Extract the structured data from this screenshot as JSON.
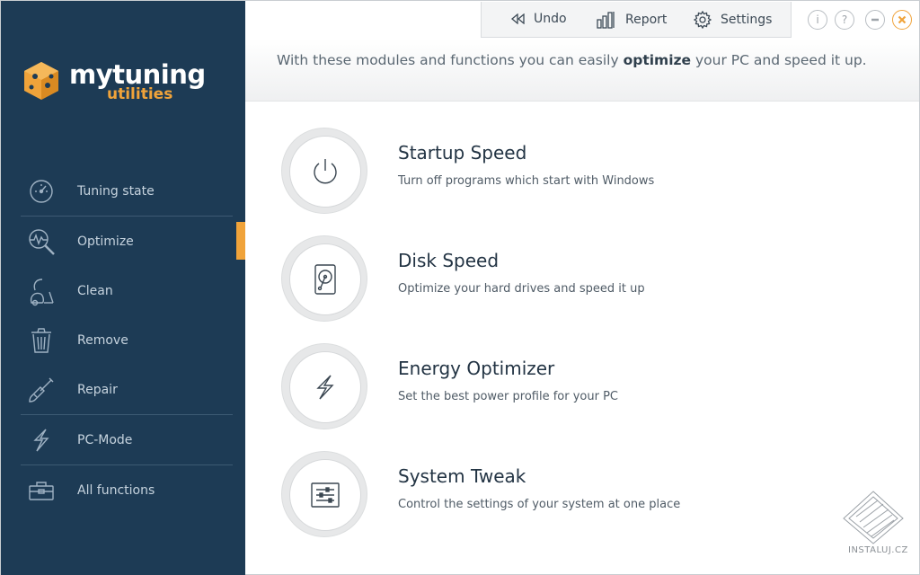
{
  "app": {
    "logo_line1": "mytuning",
    "logo_line2": "utilities"
  },
  "sidebar": {
    "items": [
      {
        "label": "Tuning state",
        "icon": "speedometer-icon"
      },
      {
        "label": "Optimize",
        "icon": "optimize-magnifier-icon",
        "active": true
      },
      {
        "label": "Clean",
        "icon": "vacuum-icon"
      },
      {
        "label": "Remove",
        "icon": "trash-icon"
      },
      {
        "label": "Repair",
        "icon": "screwdriver-icon"
      },
      {
        "label": "PC-Mode",
        "icon": "lightning-icon"
      },
      {
        "label": "All functions",
        "icon": "toolbox-icon"
      }
    ]
  },
  "toolbar": {
    "undo_label": "Undo",
    "report_label": "Report",
    "settings_label": "Settings"
  },
  "window_controls": {
    "info": "i",
    "help": "?"
  },
  "header": {
    "text_before": "With these modules and functions you can easily ",
    "text_bold": "optimize",
    "text_after": " your PC and speed it up."
  },
  "modules": [
    {
      "title": "Startup Speed",
      "description": "Turn off programs which start with Windows",
      "icon": "power-icon"
    },
    {
      "title": "Disk Speed",
      "description": "Optimize your hard drives and speed it up",
      "icon": "hard-drive-icon"
    },
    {
      "title": "Energy Optimizer",
      "description": "Set the best power profile for your PC",
      "icon": "lightning-icon"
    },
    {
      "title": "System Tweak",
      "description": "Control the settings of your system at one place",
      "icon": "sliders-icon"
    }
  ],
  "watermark": {
    "text": "INSTALUJ.CZ"
  },
  "colors": {
    "sidebar_bg": "#1d3b55",
    "accent": "#f0a33a",
    "text_dark": "#233444"
  }
}
